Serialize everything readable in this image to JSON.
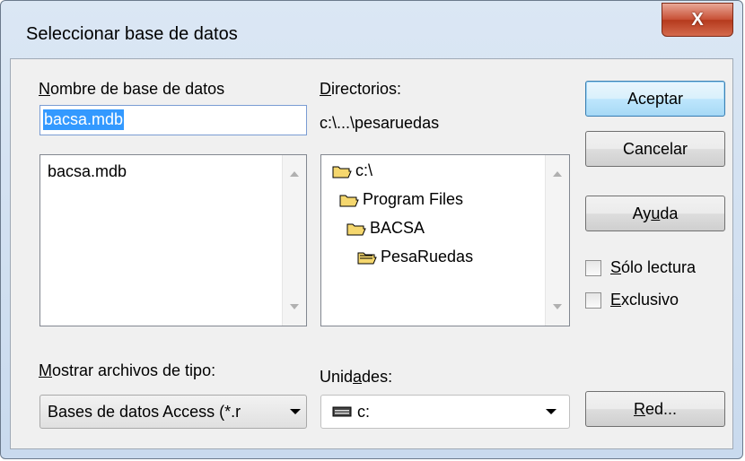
{
  "window": {
    "title": "Seleccionar base de datos",
    "close_label": "X"
  },
  "dbname": {
    "label_prefix": "N",
    "label_rest": "ombre de base de datos",
    "value": "bacsa.mdb",
    "files": [
      "bacsa.mdb"
    ]
  },
  "directories": {
    "label_prefix": "D",
    "label_rest": "irectorios:",
    "current_path": "c:\\...\\pesaruedas",
    "tree": [
      "c:\\",
      "Program Files",
      "BACSA",
      "PesaRuedas"
    ]
  },
  "filetype": {
    "label_prefix": "M",
    "label_rest": "ostrar archivos de tipo:",
    "selected": "Bases de datos Access (*.r"
  },
  "drives": {
    "label_pre": "Unid",
    "label_accel": "a",
    "label_post": "des:",
    "selected": "c:"
  },
  "buttons": {
    "accept": "Aceptar",
    "cancel": "Cancelar",
    "help_pre": "Ay",
    "help_accel": "u",
    "help_post": "da",
    "network_accel": "R",
    "network_post": "ed..."
  },
  "options": {
    "readonly_accel": "S",
    "readonly_rest": "ólo lectura",
    "exclusive_accel": "E",
    "exclusive_rest": "xclusivo"
  },
  "icons": {
    "folder_open": "folder-open-icon",
    "drive": "drive-icon"
  }
}
